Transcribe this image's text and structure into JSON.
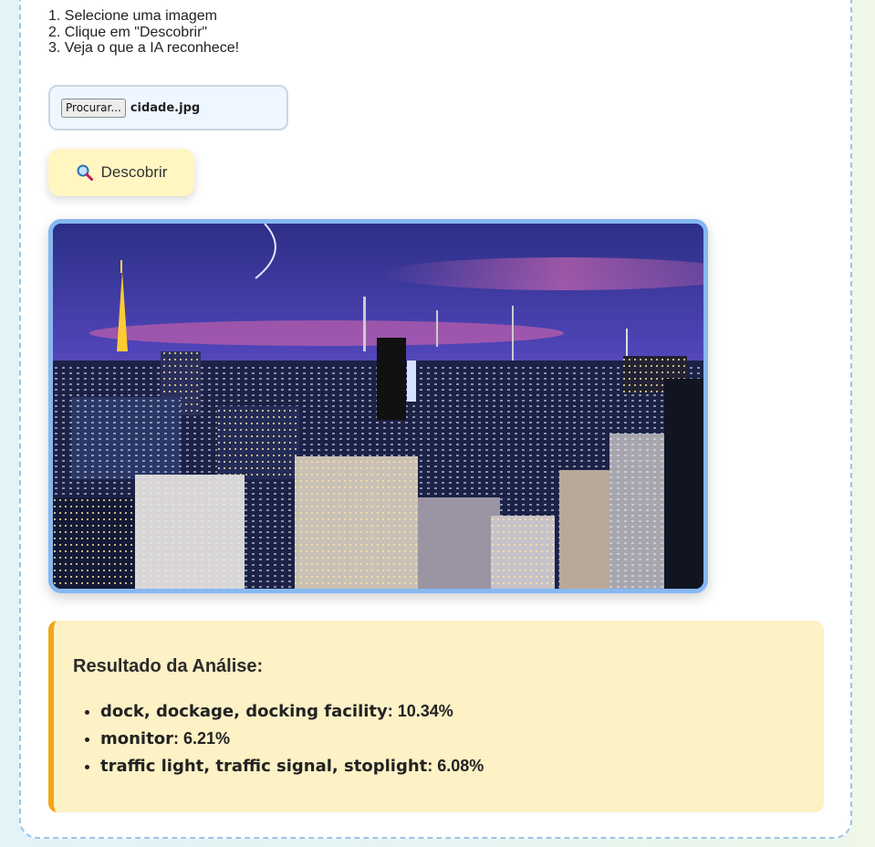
{
  "instructions": [
    "1. Selecione uma imagem",
    "2. Clique em \"Descobrir\"",
    "3. Veja o que a IA reconhece!"
  ],
  "file_input": {
    "button_label": "Procurar...",
    "file_name": "cidade.jpg"
  },
  "discover_button": {
    "label": "Descobrir",
    "icon": "magnifier-icon"
  },
  "result": {
    "title": "Resultado da Análise:",
    "predictions": [
      {
        "label": "dock, dockage, docking facility",
        "score": ": 10.34%"
      },
      {
        "label": "monitor",
        "score": ": 6.21%"
      },
      {
        "label": "traffic light, traffic signal, stoplight",
        "score": ": 6.08%"
      }
    ]
  },
  "colors": {
    "accent_border": "#86b8f2",
    "result_bg": "#fdf1c6",
    "result_bar": "#f2a516",
    "button_bg": "#fff6c2"
  }
}
